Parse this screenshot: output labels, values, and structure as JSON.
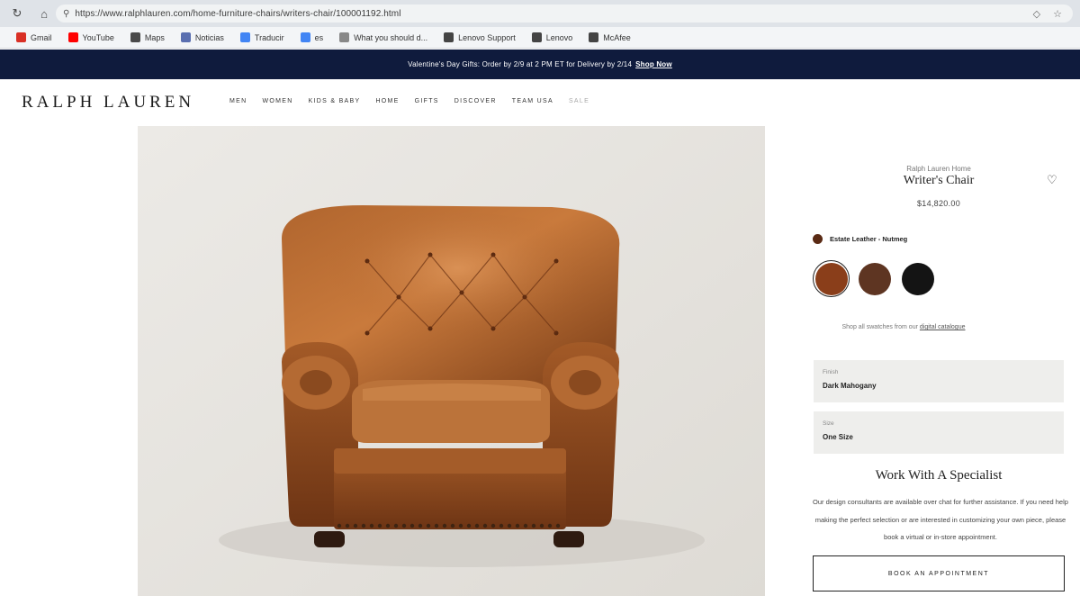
{
  "browser": {
    "url": "https://www.ralphlauren.com/home-furniture-chairs/writers-chair/100001192.html",
    "bookmarks": [
      {
        "label": "Gmail",
        "icon": "gmail-icon",
        "color": "#d93025"
      },
      {
        "label": "YouTube",
        "icon": "youtube-icon",
        "color": "#ff0000"
      },
      {
        "label": "Maps",
        "icon": "maps-icon",
        "color": "#4a4a4a"
      },
      {
        "label": "Noticias",
        "icon": "news-icon",
        "color": "#5a6fb0"
      },
      {
        "label": "Traducir",
        "icon": "translate-icon",
        "color": "#4285f4"
      },
      {
        "label": "es",
        "icon": "translate-icon",
        "color": "#4285f4"
      },
      {
        "label": "What you should d...",
        "icon": "page-icon",
        "color": "#888888"
      },
      {
        "label": "Lenovo Support",
        "icon": "globe-icon",
        "color": "#444444"
      },
      {
        "label": "Lenovo",
        "icon": "globe-icon",
        "color": "#444444"
      },
      {
        "label": "McAfee",
        "icon": "globe-icon",
        "color": "#444444"
      }
    ]
  },
  "promo": {
    "text": "Valentine's Day Gifts: Order by 2/9 at 2 PM ET for Delivery by 2/14",
    "link": "Shop Now",
    "background": "#0f1b3d"
  },
  "header": {
    "logo": "RALPH LAUREN",
    "nav": [
      "MEN",
      "WOMEN",
      "KIDS & BABY",
      "HOME",
      "GIFTS",
      "DISCOVER",
      "TEAM USA",
      "SALE"
    ]
  },
  "product": {
    "brand": "Ralph Lauren Home",
    "title": "Writer's Chair",
    "price": "$14,820.00",
    "color_label": "Estate Leather - Nutmeg",
    "swatch_colors": [
      "#8a3e1a",
      "#5e3522",
      "#141414"
    ],
    "shop_swatches_text": "Shop all swatches from our",
    "shop_swatches_link": "digital catalogue",
    "fields": [
      {
        "label": "Finish",
        "value": "Dark Mahogany"
      },
      {
        "label": "Size",
        "value": "One Size"
      }
    ]
  },
  "specialist": {
    "title": "Work With A Specialist",
    "text": "Our design consultants are available over chat for further assistance. If you need help making the perfect selection or are interested in customizing your own piece, please book a virtual or in-store appointment.",
    "button": "BOOK AN APPOINTMENT"
  }
}
